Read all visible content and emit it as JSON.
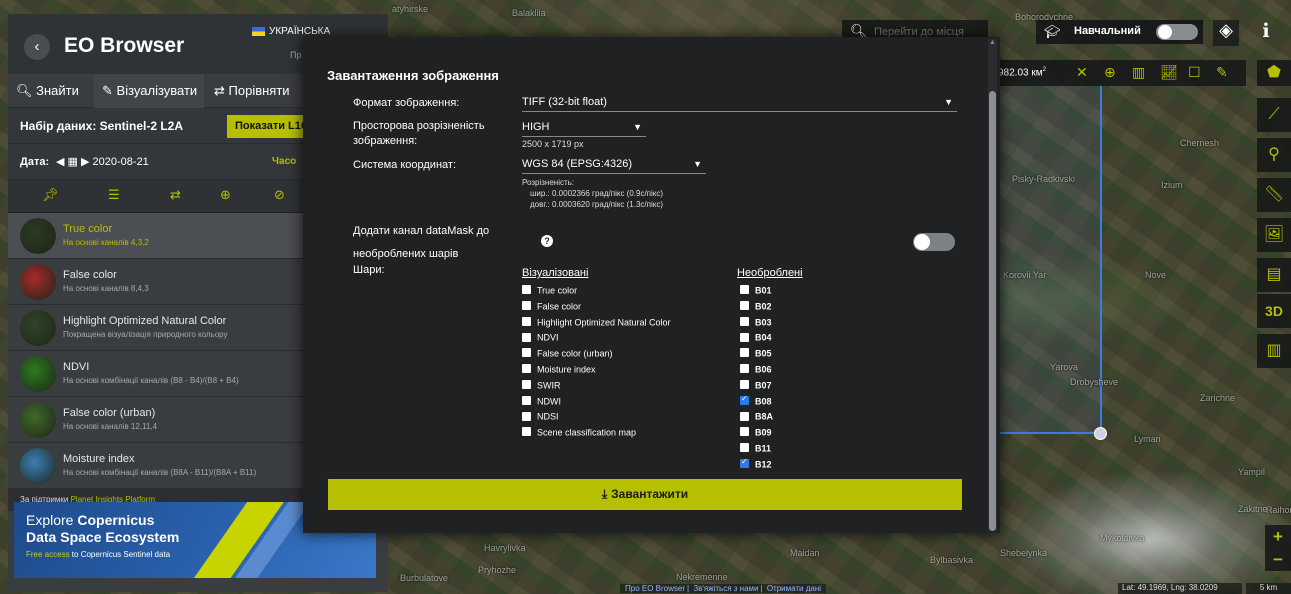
{
  "app": {
    "title": "EO Browser",
    "language": "УКРАЇНСЬКА",
    "language_sub": "Пр"
  },
  "nav_tabs": [
    {
      "label": "Знайти",
      "icon": "search-icon"
    },
    {
      "label": "Візуалізувати",
      "icon": "brush-icon",
      "active": true
    },
    {
      "label": "Порівняти",
      "icon": "compare-icon"
    }
  ],
  "dataset": {
    "label": "Набір даних: Sentinel-2 L2A",
    "show_l1c": "Показати L1C"
  },
  "date": {
    "label": "Дата:",
    "value": "2020-08-21",
    "extra": "Часо"
  },
  "toolbar_icons": [
    "pin-icon",
    "sliders-icon",
    "swap-icon",
    "crosshair-icon",
    "eye-off-icon"
  ],
  "layers": [
    {
      "name": "True color",
      "desc": "На основі каналів 4,3,2",
      "active": true,
      "thumb": "#2b3a22"
    },
    {
      "name": "False color",
      "desc": "На основі каналів 8,4,3",
      "thumb": "#a72a2a"
    },
    {
      "name": "Highlight Optimized Natural Color",
      "desc": "Покращена візуалізація природного кольору",
      "thumb": "#2f4528"
    },
    {
      "name": "NDVI",
      "desc": "На основі комбінації каналів (B8 - B4)/(B8 + B4)",
      "thumb": "#2d7a1f"
    },
    {
      "name": "False color (urban)",
      "desc": "На основі каналів 12,11,4",
      "thumb": "#3f6a2a"
    },
    {
      "name": "Moisture index",
      "desc": "На основі комбінації каналів (B8A - B11)/(B8A + B11)",
      "thumb": "#3b7fb5"
    }
  ],
  "supported": {
    "text": "За підтримки",
    "link": "Planet Insights Platform"
  },
  "promo": {
    "line1_prefix": "Explore ",
    "line1_bold": "Copernicus",
    "line2": "Data Space Ecosystem",
    "line3_hl": "Free access",
    "line3_rest": " to Copernicus Sentinel data"
  },
  "search": {
    "placeholder": "Перейти до місця"
  },
  "tutorial": {
    "label": "Навчальний"
  },
  "aoi": {
    "area": "982.03 км",
    "area_unit_sup": "2"
  },
  "side_tools": [
    "ruler-line-icon",
    "location-pin-icon",
    "ruler-icon",
    "image-download-icon",
    "film-icon",
    "3D",
    "chart-icon"
  ],
  "coords": {
    "text": "Lat: 49.1969, Lng: 38.0209"
  },
  "scale": {
    "text": "5 km"
  },
  "attribution": [
    "Про EO Browser",
    "Зв'яжіться з нами",
    "Отримати дані"
  ],
  "map_labels": [
    {
      "text": "Balakliia"
    },
    {
      "text": "atyhirske"
    },
    {
      "text": "Havrylivka"
    },
    {
      "text": "Pryhozhe"
    },
    {
      "text": "Burbulatove"
    },
    {
      "text": "Maidan"
    },
    {
      "text": "Nekremenne"
    },
    {
      "text": "Bylbasivka"
    },
    {
      "text": "Shebelynka"
    },
    {
      "text": "Mykolaivka"
    },
    {
      "text": "Raihorodok"
    },
    {
      "text": "Zakitne"
    },
    {
      "text": "Yampil"
    },
    {
      "text": "Lyman"
    },
    {
      "text": "Zarichne"
    },
    {
      "text": "Drobysheve"
    },
    {
      "text": "Yarova"
    },
    {
      "text": "Korovii Yar"
    },
    {
      "text": "Nove"
    },
    {
      "text": "Izium"
    },
    {
      "text": "Chernesh"
    },
    {
      "text": "Pisky-Radkivski"
    },
    {
      "text": "Bohorodychne"
    }
  ],
  "modal": {
    "title": "Завантаження зображення",
    "format_label": "Формат зображення:",
    "format_value": "TIFF (32-bit float)",
    "resolution_label": "Просторова розрізненість зображення:",
    "resolution_value": "HIGH",
    "resolution_px": "2500 x 1719 px",
    "crs_label": "Система координат:",
    "crs_value": "WGS 84 (EPSG:4326)",
    "crs_res_title": "Розрізненість:",
    "crs_res_lat": "шир.: 0.0002366 град/пікс (0.9с/пікс)",
    "crs_res_lng": "довг.: 0.0003620 град/пікс (1.3с/пікс)",
    "datamask_label_1": "Додати канал dataMask до",
    "datamask_label_2": "необроблених шарів",
    "help": "?",
    "layers_label": "Шари:",
    "visualized_head": "Візуалізовані",
    "raw_head": "Необроблені",
    "visualized": [
      {
        "label": "True color",
        "checked": false
      },
      {
        "label": "False color",
        "checked": false
      },
      {
        "label": "Highlight Optimized Natural Color",
        "checked": false
      },
      {
        "label": "NDVI",
        "checked": false
      },
      {
        "label": "False color (urban)",
        "checked": false
      },
      {
        "label": "Moisture index",
        "checked": false
      },
      {
        "label": "SWIR",
        "checked": false
      },
      {
        "label": "NDWI",
        "checked": false
      },
      {
        "label": "NDSI",
        "checked": false
      },
      {
        "label": "Scene classification map",
        "checked": false
      }
    ],
    "raw": [
      {
        "label": "B01",
        "checked": false
      },
      {
        "label": "B02",
        "checked": false
      },
      {
        "label": "B03",
        "checked": false
      },
      {
        "label": "B04",
        "checked": false
      },
      {
        "label": "B05",
        "checked": false
      },
      {
        "label": "B06",
        "checked": false
      },
      {
        "label": "B07",
        "checked": false
      },
      {
        "label": "B08",
        "checked": true
      },
      {
        "label": "B8A",
        "checked": false
      },
      {
        "label": "B09",
        "checked": false
      },
      {
        "label": "B11",
        "checked": false
      },
      {
        "label": "B12",
        "checked": true
      }
    ],
    "download_label": "Завантажити"
  }
}
